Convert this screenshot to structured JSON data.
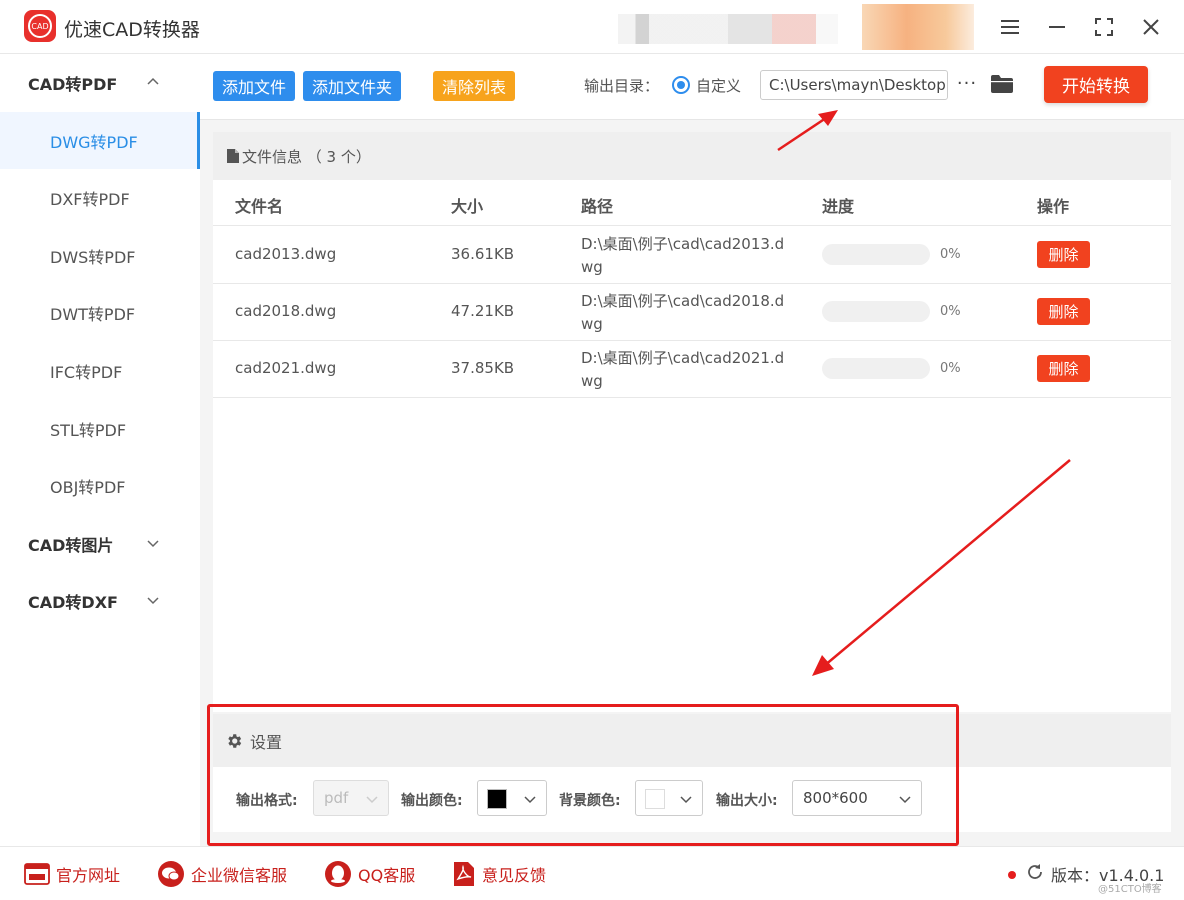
{
  "app": {
    "logo_text": "CAD",
    "title": "优速CAD转换器"
  },
  "window_controls": [
    "menu-icon",
    "minimize-icon",
    "maximize-icon",
    "close-icon"
  ],
  "sidebar": {
    "groups": [
      {
        "label": "CAD转PDF",
        "expanded": true,
        "items": [
          "DWG转PDF",
          "DXF转PDF",
          "DWS转PDF",
          "DWT转PDF",
          "IFC转PDF",
          "STL转PDF",
          "OBJ转PDF"
        ],
        "active_index": 0
      },
      {
        "label": "CAD转图片",
        "expanded": false
      },
      {
        "label": "CAD转DXF",
        "expanded": false
      }
    ]
  },
  "toolbar": {
    "add_file": "添加文件",
    "add_folder": "添加文件夹",
    "clear_list": "清除列表",
    "output_dir_label": "输出目录：",
    "custom_label": "自定义",
    "output_path": "C:\\Users\\mayn\\Desktop",
    "more": "···",
    "start": "开始转换"
  },
  "files": {
    "header": "文件信息 （ 3 个）",
    "columns": {
      "name": "文件名",
      "size": "大小",
      "path": "路径",
      "progress": "进度",
      "action": "操作"
    },
    "rows": [
      {
        "name": "cad2013.dwg",
        "size": "36.61KB",
        "path": "D:\\桌面\\例子\\cad\\cad2013.dwg",
        "progress": 0,
        "progress_label": "0%",
        "action": "删除"
      },
      {
        "name": "cad2018.dwg",
        "size": "47.21KB",
        "path": "D:\\桌面\\例子\\cad\\cad2018.dwg",
        "progress": 0,
        "progress_label": "0%",
        "action": "删除"
      },
      {
        "name": "cad2021.dwg",
        "size": "37.85KB",
        "path": "D:\\桌面\\例子\\cad\\cad2021.dwg",
        "progress": 0,
        "progress_label": "0%",
        "action": "删除"
      }
    ]
  },
  "settings": {
    "title": "设置",
    "format_label": "输出格式:",
    "format_value": "pdf",
    "color_label": "输出颜色:",
    "color_value": "#000000",
    "bg_label": "背景颜色:",
    "bg_value": "#ffffff",
    "size_label": "输出大小:",
    "size_value": "800*600"
  },
  "footer": {
    "website": "官方网址",
    "wechat": "企业微信客服",
    "qq": "QQ客服",
    "feedback": "意见反馈",
    "version": "版本：v1.4.0.1",
    "watermark": "@51CTO博客"
  },
  "colors": {
    "primary": "#2e8ded",
    "orange": "#f7a31c",
    "danger": "#f1421f",
    "annotation": "#e51d1d"
  }
}
